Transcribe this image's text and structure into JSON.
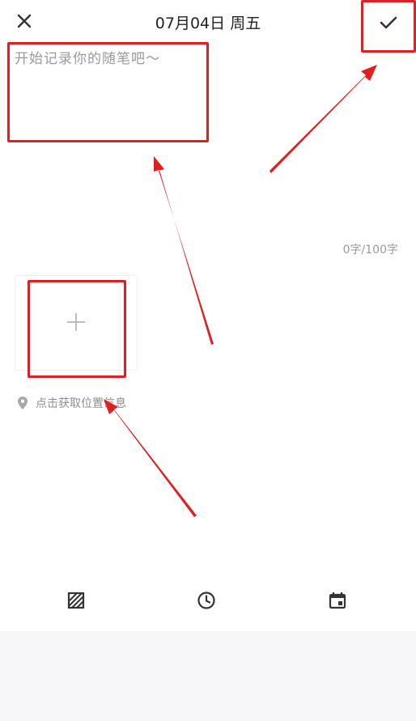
{
  "header": {
    "title": "07月04日 周五"
  },
  "editor": {
    "placeholder": "开始记录你的随笔吧～",
    "value": ""
  },
  "counter": {
    "text": "0字/100字"
  },
  "location": {
    "label": "点击获取位置信息"
  },
  "icons": {
    "close": "close-icon",
    "confirm": "check-icon",
    "add": "plus-icon",
    "location": "location-pin-icon",
    "mood": "pattern-icon",
    "time": "clock-icon",
    "date": "calendar-icon"
  },
  "annotation_color": "#e02020"
}
